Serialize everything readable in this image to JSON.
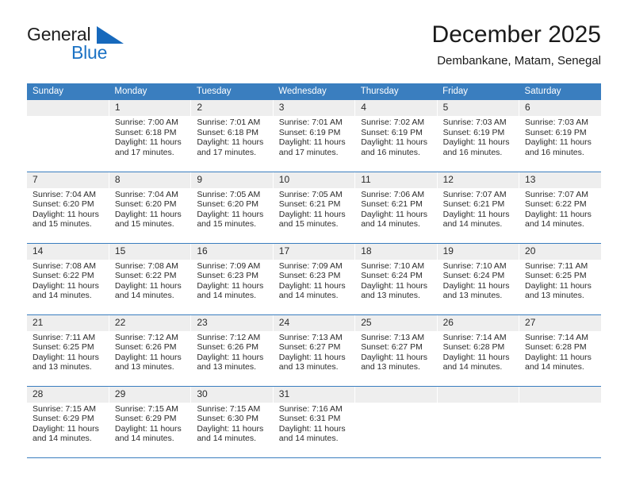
{
  "brand": {
    "word_one": "General",
    "word_two": "Blue",
    "triangle_color": "#1769bc"
  },
  "header": {
    "title": "December 2025",
    "subtitle": "Dembankane, Matam, Senegal"
  },
  "calendar": {
    "header_bg": "#3a7ebf",
    "daynum_bg": "#eeeeee",
    "weekdays": [
      "Sunday",
      "Monday",
      "Tuesday",
      "Wednesday",
      "Thursday",
      "Friday",
      "Saturday"
    ],
    "weeks": [
      [
        {
          "day": "",
          "sunrise": "",
          "sunset": "",
          "daylight": "",
          "daylight2": ""
        },
        {
          "day": "1",
          "sunrise": "Sunrise: 7:00 AM",
          "sunset": "Sunset: 6:18 PM",
          "daylight": "Daylight: 11 hours",
          "daylight2": "and 17 minutes."
        },
        {
          "day": "2",
          "sunrise": "Sunrise: 7:01 AM",
          "sunset": "Sunset: 6:18 PM",
          "daylight": "Daylight: 11 hours",
          "daylight2": "and 17 minutes."
        },
        {
          "day": "3",
          "sunrise": "Sunrise: 7:01 AM",
          "sunset": "Sunset: 6:19 PM",
          "daylight": "Daylight: 11 hours",
          "daylight2": "and 17 minutes."
        },
        {
          "day": "4",
          "sunrise": "Sunrise: 7:02 AM",
          "sunset": "Sunset: 6:19 PM",
          "daylight": "Daylight: 11 hours",
          "daylight2": "and 16 minutes."
        },
        {
          "day": "5",
          "sunrise": "Sunrise: 7:03 AM",
          "sunset": "Sunset: 6:19 PM",
          "daylight": "Daylight: 11 hours",
          "daylight2": "and 16 minutes."
        },
        {
          "day": "6",
          "sunrise": "Sunrise: 7:03 AM",
          "sunset": "Sunset: 6:19 PM",
          "daylight": "Daylight: 11 hours",
          "daylight2": "and 16 minutes."
        }
      ],
      [
        {
          "day": "7",
          "sunrise": "Sunrise: 7:04 AM",
          "sunset": "Sunset: 6:20 PM",
          "daylight": "Daylight: 11 hours",
          "daylight2": "and 15 minutes."
        },
        {
          "day": "8",
          "sunrise": "Sunrise: 7:04 AM",
          "sunset": "Sunset: 6:20 PM",
          "daylight": "Daylight: 11 hours",
          "daylight2": "and 15 minutes."
        },
        {
          "day": "9",
          "sunrise": "Sunrise: 7:05 AM",
          "sunset": "Sunset: 6:20 PM",
          "daylight": "Daylight: 11 hours",
          "daylight2": "and 15 minutes."
        },
        {
          "day": "10",
          "sunrise": "Sunrise: 7:05 AM",
          "sunset": "Sunset: 6:21 PM",
          "daylight": "Daylight: 11 hours",
          "daylight2": "and 15 minutes."
        },
        {
          "day": "11",
          "sunrise": "Sunrise: 7:06 AM",
          "sunset": "Sunset: 6:21 PM",
          "daylight": "Daylight: 11 hours",
          "daylight2": "and 14 minutes."
        },
        {
          "day": "12",
          "sunrise": "Sunrise: 7:07 AM",
          "sunset": "Sunset: 6:21 PM",
          "daylight": "Daylight: 11 hours",
          "daylight2": "and 14 minutes."
        },
        {
          "day": "13",
          "sunrise": "Sunrise: 7:07 AM",
          "sunset": "Sunset: 6:22 PM",
          "daylight": "Daylight: 11 hours",
          "daylight2": "and 14 minutes."
        }
      ],
      [
        {
          "day": "14",
          "sunrise": "Sunrise: 7:08 AM",
          "sunset": "Sunset: 6:22 PM",
          "daylight": "Daylight: 11 hours",
          "daylight2": "and 14 minutes."
        },
        {
          "day": "15",
          "sunrise": "Sunrise: 7:08 AM",
          "sunset": "Sunset: 6:22 PM",
          "daylight": "Daylight: 11 hours",
          "daylight2": "and 14 minutes."
        },
        {
          "day": "16",
          "sunrise": "Sunrise: 7:09 AM",
          "sunset": "Sunset: 6:23 PM",
          "daylight": "Daylight: 11 hours",
          "daylight2": "and 14 minutes."
        },
        {
          "day": "17",
          "sunrise": "Sunrise: 7:09 AM",
          "sunset": "Sunset: 6:23 PM",
          "daylight": "Daylight: 11 hours",
          "daylight2": "and 14 minutes."
        },
        {
          "day": "18",
          "sunrise": "Sunrise: 7:10 AM",
          "sunset": "Sunset: 6:24 PM",
          "daylight": "Daylight: 11 hours",
          "daylight2": "and 13 minutes."
        },
        {
          "day": "19",
          "sunrise": "Sunrise: 7:10 AM",
          "sunset": "Sunset: 6:24 PM",
          "daylight": "Daylight: 11 hours",
          "daylight2": "and 13 minutes."
        },
        {
          "day": "20",
          "sunrise": "Sunrise: 7:11 AM",
          "sunset": "Sunset: 6:25 PM",
          "daylight": "Daylight: 11 hours",
          "daylight2": "and 13 minutes."
        }
      ],
      [
        {
          "day": "21",
          "sunrise": "Sunrise: 7:11 AM",
          "sunset": "Sunset: 6:25 PM",
          "daylight": "Daylight: 11 hours",
          "daylight2": "and 13 minutes."
        },
        {
          "day": "22",
          "sunrise": "Sunrise: 7:12 AM",
          "sunset": "Sunset: 6:26 PM",
          "daylight": "Daylight: 11 hours",
          "daylight2": "and 13 minutes."
        },
        {
          "day": "23",
          "sunrise": "Sunrise: 7:12 AM",
          "sunset": "Sunset: 6:26 PM",
          "daylight": "Daylight: 11 hours",
          "daylight2": "and 13 minutes."
        },
        {
          "day": "24",
          "sunrise": "Sunrise: 7:13 AM",
          "sunset": "Sunset: 6:27 PM",
          "daylight": "Daylight: 11 hours",
          "daylight2": "and 13 minutes."
        },
        {
          "day": "25",
          "sunrise": "Sunrise: 7:13 AM",
          "sunset": "Sunset: 6:27 PM",
          "daylight": "Daylight: 11 hours",
          "daylight2": "and 13 minutes."
        },
        {
          "day": "26",
          "sunrise": "Sunrise: 7:14 AM",
          "sunset": "Sunset: 6:28 PM",
          "daylight": "Daylight: 11 hours",
          "daylight2": "and 14 minutes."
        },
        {
          "day": "27",
          "sunrise": "Sunrise: 7:14 AM",
          "sunset": "Sunset: 6:28 PM",
          "daylight": "Daylight: 11 hours",
          "daylight2": "and 14 minutes."
        }
      ],
      [
        {
          "day": "28",
          "sunrise": "Sunrise: 7:15 AM",
          "sunset": "Sunset: 6:29 PM",
          "daylight": "Daylight: 11 hours",
          "daylight2": "and 14 minutes."
        },
        {
          "day": "29",
          "sunrise": "Sunrise: 7:15 AM",
          "sunset": "Sunset: 6:29 PM",
          "daylight": "Daylight: 11 hours",
          "daylight2": "and 14 minutes."
        },
        {
          "day": "30",
          "sunrise": "Sunrise: 7:15 AM",
          "sunset": "Sunset: 6:30 PM",
          "daylight": "Daylight: 11 hours",
          "daylight2": "and 14 minutes."
        },
        {
          "day": "31",
          "sunrise": "Sunrise: 7:16 AM",
          "sunset": "Sunset: 6:31 PM",
          "daylight": "Daylight: 11 hours",
          "daylight2": "and 14 minutes."
        },
        {
          "day": "",
          "sunrise": "",
          "sunset": "",
          "daylight": "",
          "daylight2": ""
        },
        {
          "day": "",
          "sunrise": "",
          "sunset": "",
          "daylight": "",
          "daylight2": ""
        },
        {
          "day": "",
          "sunrise": "",
          "sunset": "",
          "daylight": "",
          "daylight2": ""
        }
      ]
    ]
  }
}
